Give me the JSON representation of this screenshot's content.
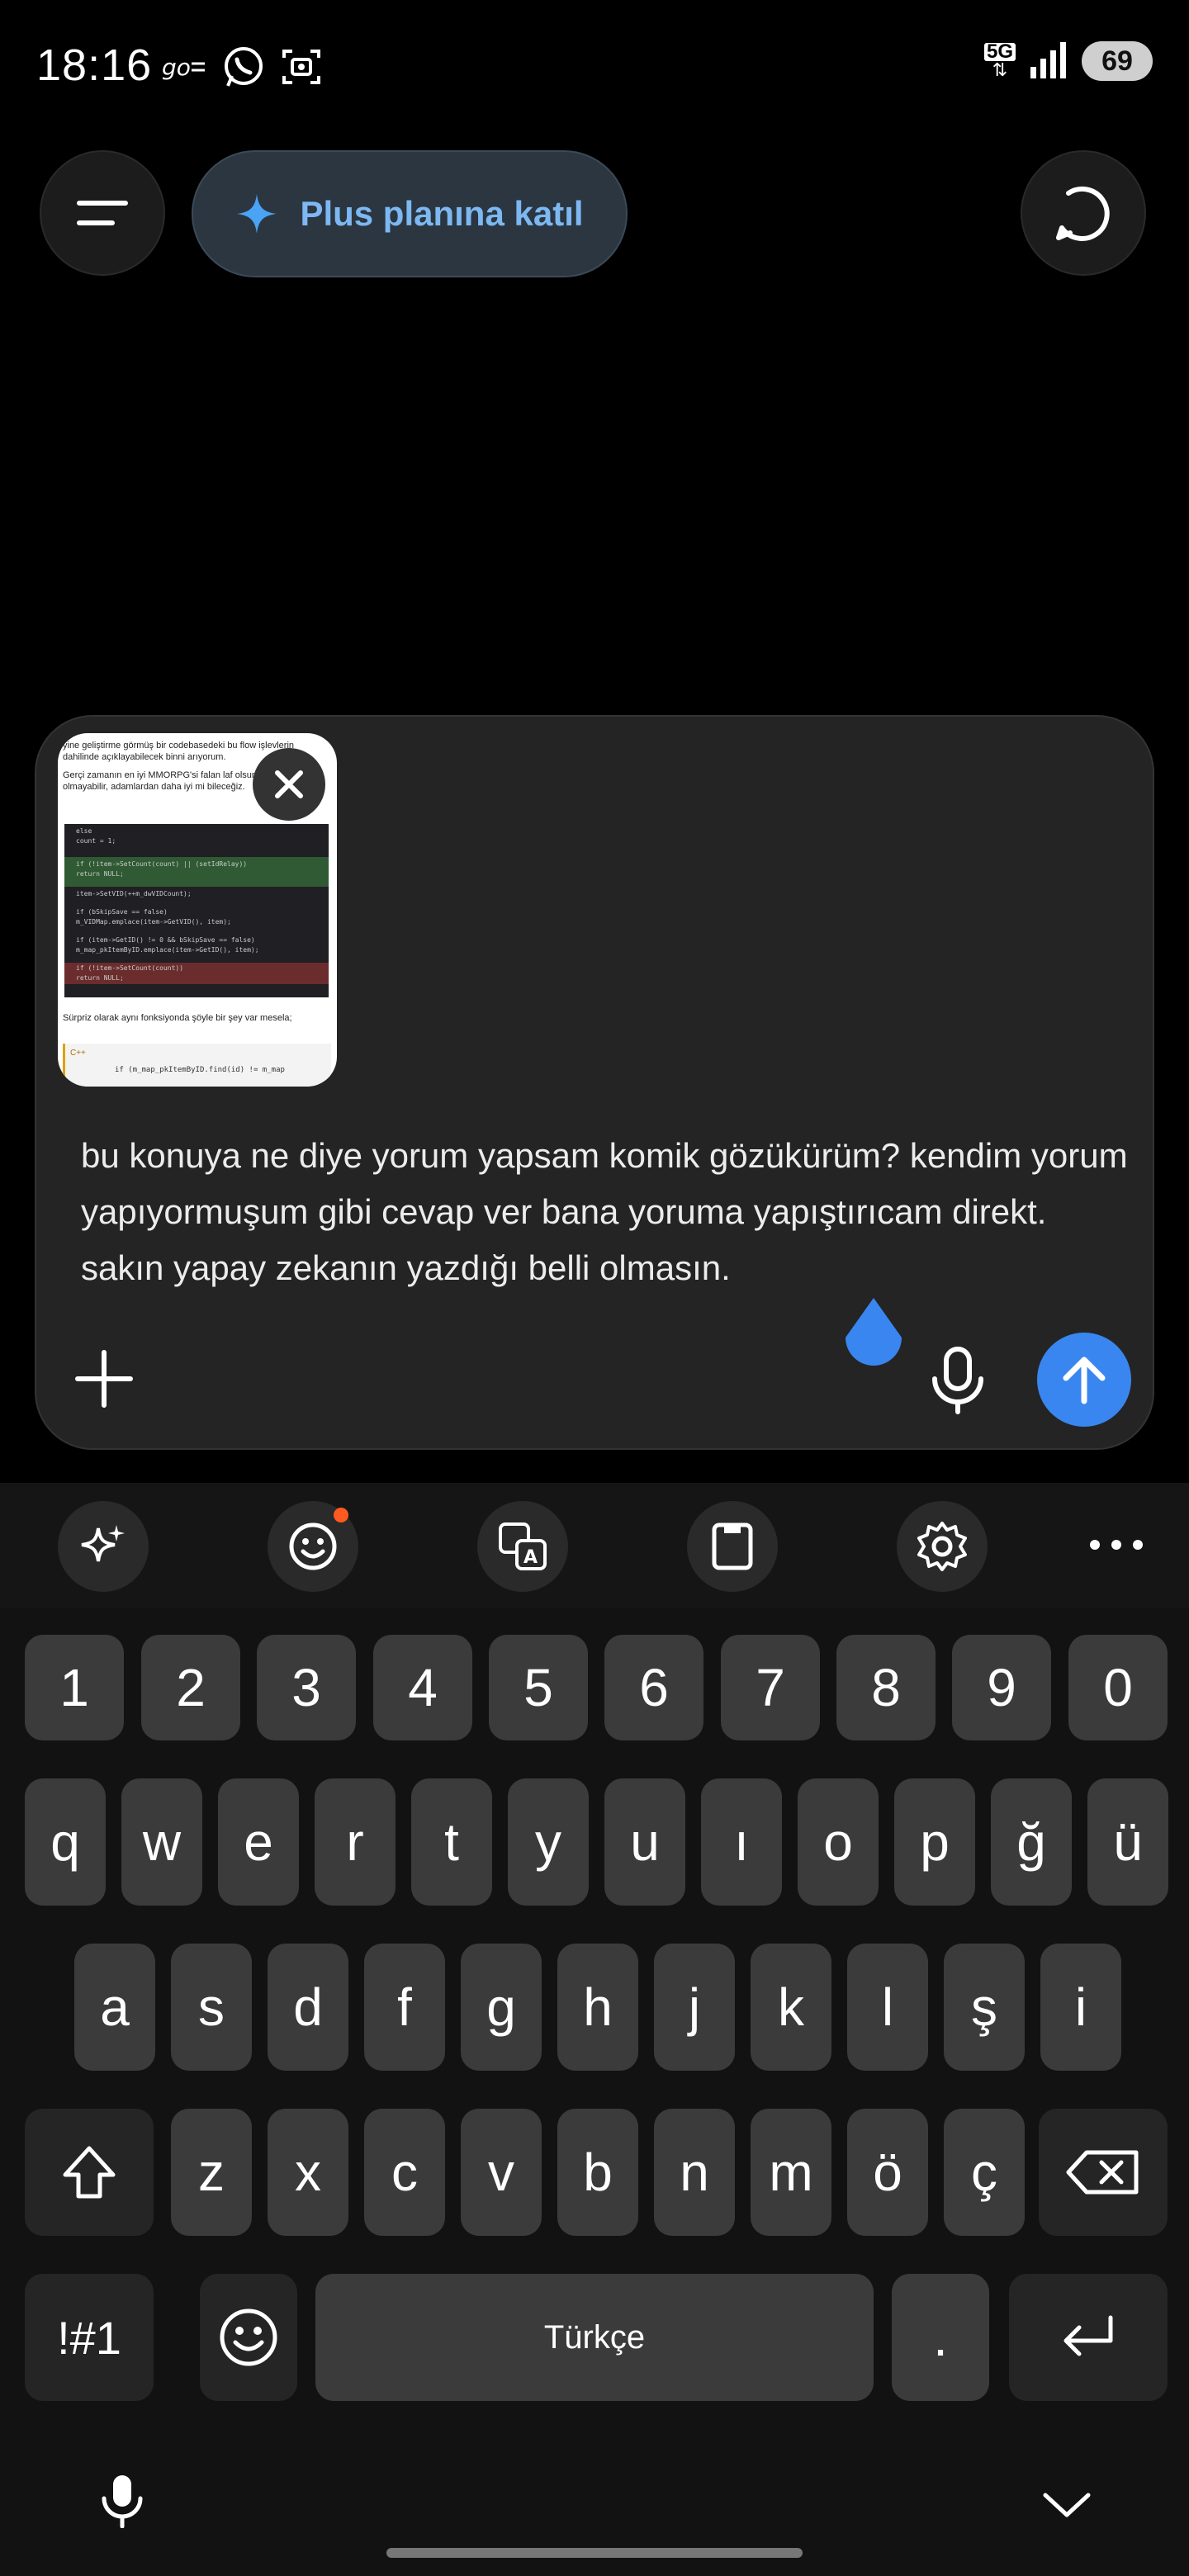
{
  "status_bar": {
    "time": "18:16",
    "network": "5G",
    "battery": "69",
    "icons": [
      "goo-icon",
      "whatsapp-icon",
      "screenshot-icon",
      "signal-icon"
    ]
  },
  "top_bar": {
    "menu_icon": "menu-icon",
    "plus_label": "Plus planına katıl",
    "new_chat_icon": "new-chat-icon"
  },
  "attachment": {
    "thumb_lines_top": [
      "yine geliştirme görmüş bir codebasedeki bu flow işlevlerin",
      "dahilinde açıklayabilecek binni arıyorum.",
      "",
      "Gerçi zamanın en iyi MMORPG'si falan laf olsun",
      "olmayabilir, adamlardan daha iyi mi bileceğiz."
    ],
    "code_lines": [
      "else",
      "   count = 1;",
      "",
      "if (!item->SetCount(count) || (setIdRelay))",
      "   return NULL;",
      "",
      "item->SetVID(++m_dwVIDCount);",
      "",
      "if (bSkipSave == false)",
      "   m_VIDMap.emplace(item->GetVID(), item);",
      "",
      "if (item->GetID() != 0 && bSkipSave == false)",
      "   m_map_pkItemByID.emplace(item->GetID(), item);",
      "",
      "if (!item->SetCount(count))",
      "   return NULL;"
    ],
    "thumb_lines_bottom": [
      "Sürpriz olarak aynı fonksiyonda şöyle bir şey var mesela;",
      "C++",
      "if (m_map_pkItemByID.find(id) != m_map"
    ]
  },
  "composer": {
    "message": "bu konuya ne diye yorum yapsam komik gözükürüm? kendim yorum yapıyormuşum gibi cevap ver bana yoruma yapıştırıcam direkt. sakın yapay zekanın yazdığı belli olmasın."
  },
  "keyboard": {
    "toolbar": [
      "sparkle-icon",
      "emoji-icon",
      "translate-icon",
      "clipboard-icon",
      "settings-icon",
      "more-icon"
    ],
    "row_numbers": [
      "1",
      "2",
      "3",
      "4",
      "5",
      "6",
      "7",
      "8",
      "9",
      "0"
    ],
    "row1": [
      "q",
      "w",
      "e",
      "r",
      "t",
      "y",
      "u",
      "ı",
      "o",
      "p",
      "ğ",
      "ü"
    ],
    "row2": [
      "a",
      "s",
      "d",
      "f",
      "g",
      "h",
      "j",
      "k",
      "l",
      "ş",
      "i"
    ],
    "row3": [
      "z",
      "x",
      "c",
      "v",
      "b",
      "n",
      "m",
      "ö",
      "ç"
    ],
    "symbols_label": "!#1",
    "space_label": "Türkçe",
    "period_label": "."
  }
}
